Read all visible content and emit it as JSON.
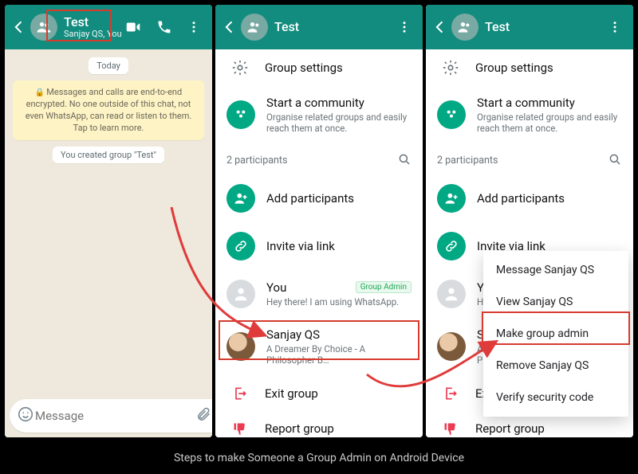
{
  "caption": "Steps to make Someone a Group Admin on Android Device",
  "chat": {
    "title": "Test",
    "subtitle": "Sanjay QS, You",
    "dateLabel": "Today",
    "e2eText": "Messages and calls are end-to-end encrypted. No one outside of this chat, not even WhatsApp, can read or listen to them. Tap to learn more.",
    "createdText": "You created group \"Test\"",
    "placeholder": "Message"
  },
  "info": {
    "title": "Test",
    "groupSettings": "Group settings",
    "community": {
      "title": "Start a community",
      "sub": "Organise related groups and easily reach them at once."
    },
    "participantsLabel": "2 participants",
    "addParticipants": "Add participants",
    "inviteLink": "Invite via link",
    "you": {
      "name": "You",
      "status": "Hey there! I am using WhatsApp.",
      "badge": "Group Admin"
    },
    "sanjay": {
      "name": "Sanjay QS",
      "status": "A Dreamer By Choice - A Philosopher B…"
    },
    "exit": "Exit group",
    "report": "Report group"
  },
  "menu": {
    "message": "Message Sanjay QS",
    "view": "View Sanjay QS",
    "makeAdmin": "Make group admin",
    "remove": "Remove Sanjay QS",
    "verify": "Verify security code"
  }
}
